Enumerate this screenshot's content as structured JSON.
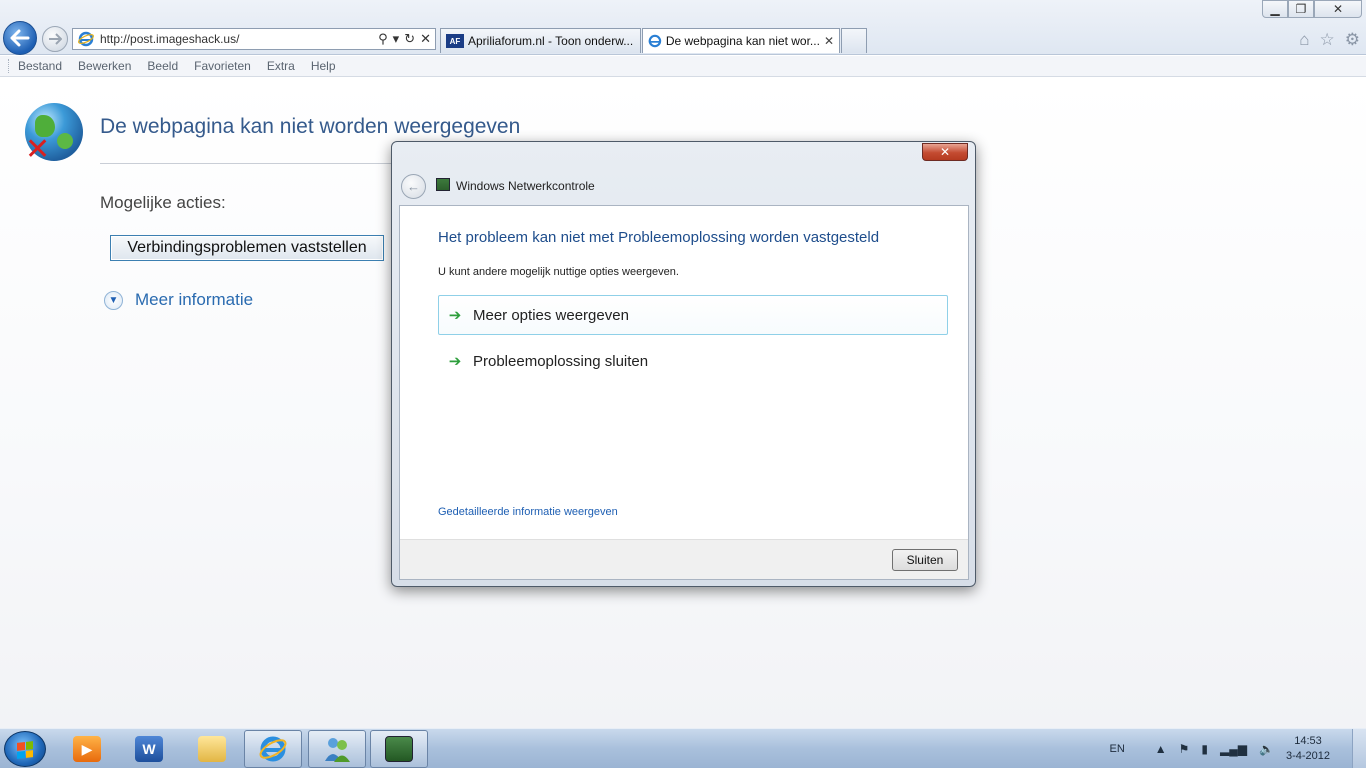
{
  "browser": {
    "url": "http://post.imageshack.us/",
    "tabs": [
      {
        "label": "Apriliaforum.nl - Toon onderw...",
        "badge": "AF"
      },
      {
        "label": "De webpagina kan niet wor...",
        "close": "✕"
      }
    ],
    "menu": [
      "Bestand",
      "Bewerken",
      "Beeld",
      "Favorieten",
      "Extra",
      "Help"
    ]
  },
  "page": {
    "title": "De webpagina kan niet worden weergegeven",
    "actions_label": "Mogelijke acties:",
    "diagnose_button": "Verbindingsproblemen vaststellen",
    "more_info": "Meer informatie"
  },
  "dialog": {
    "app_title": "Windows Netwerkcontrole",
    "heading": "Het probleem kan niet met Probleemoplossing worden vastgesteld",
    "subtext": "U kunt andere mogelijk nuttige opties weergeven.",
    "option1": "Meer opties weergeven",
    "option2": "Probleemoplossing sluiten",
    "details_link": "Gedetailleerde informatie weergeven",
    "close_button": "Sluiten"
  },
  "taskbar": {
    "lang": "EN",
    "time": "14:53",
    "date": "3-4-2012",
    "items": [
      "media-player",
      "word",
      "explorer",
      "internet-explorer",
      "messenger",
      "network-diagnostics"
    ]
  },
  "colors": {
    "accent_blue": "#1e4d8c",
    "link_blue": "#1e5fb3",
    "arrow_green": "#2e9e3c"
  }
}
